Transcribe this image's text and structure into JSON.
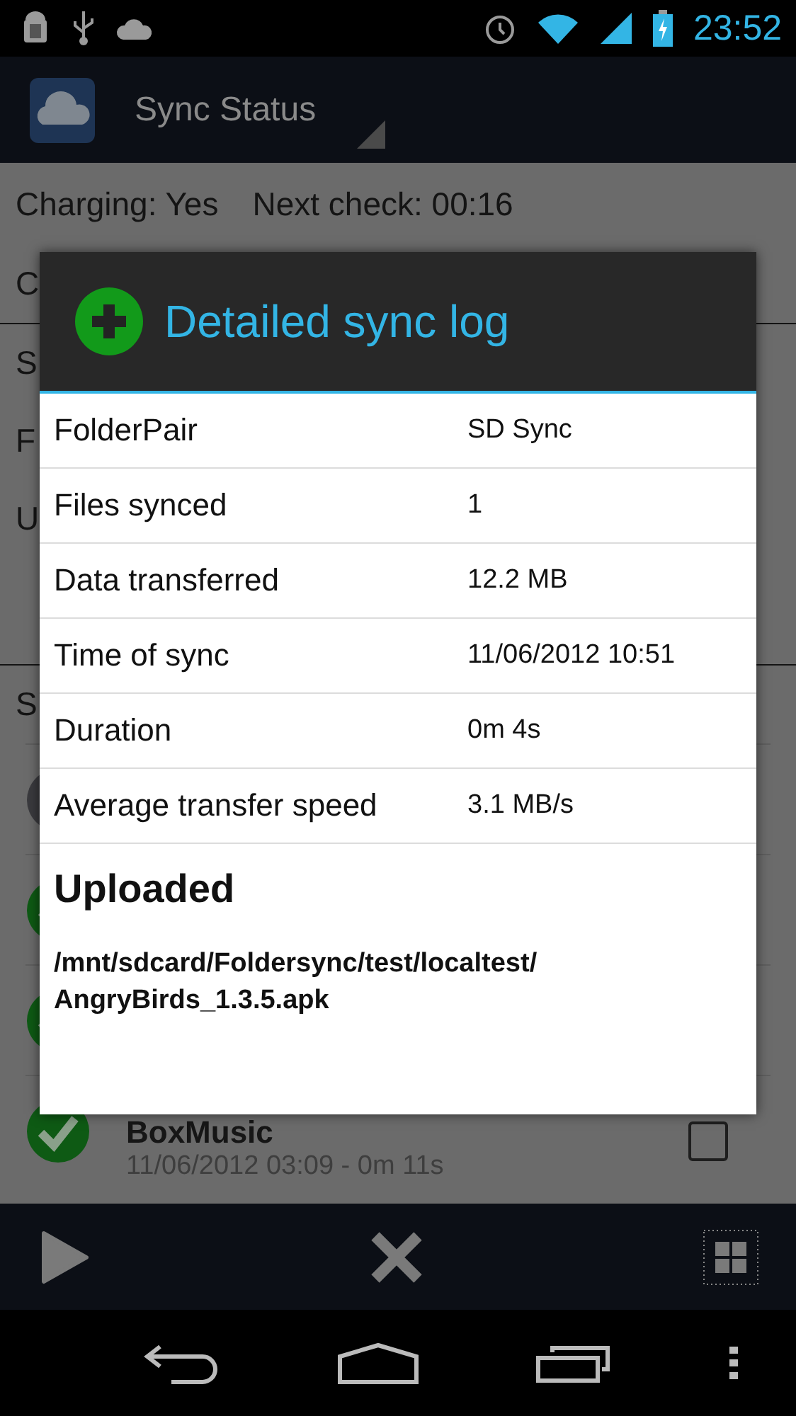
{
  "status_bar": {
    "time": "23:52"
  },
  "action_bar": {
    "title": "Sync Status"
  },
  "summary": {
    "charging": "Charging: Yes",
    "next_check": "Next check: 00:16"
  },
  "sections": [
    {
      "kind": "label",
      "text": "C"
    },
    {
      "kind": "rule"
    },
    {
      "kind": "label",
      "text": "S"
    },
    {
      "kind": "label",
      "text": "F"
    },
    {
      "kind": "label",
      "text": "U"
    },
    {
      "kind": "gap"
    },
    {
      "kind": "rule"
    },
    {
      "kind": "label",
      "text": "S"
    }
  ],
  "sync_rows": [
    {
      "kind": "idle"
    },
    {
      "kind": "done"
    },
    {
      "kind": "done"
    },
    {
      "kind": "done",
      "name": "BoxMusic",
      "detail": "11/06/2012 03:09 - 0m 11s",
      "checked": false
    }
  ],
  "dialog": {
    "title": "Detailed sync log",
    "rows": [
      {
        "label": "FolderPair",
        "value": "SD Sync"
      },
      {
        "label": "Files synced",
        "value": "1"
      },
      {
        "label": "Data transferred",
        "value": "12.2 MB"
      },
      {
        "label": "Time of sync",
        "value": "11/06/2012 10:51"
      },
      {
        "label": "Duration",
        "value": "0m 4s"
      },
      {
        "label": "Average transfer speed",
        "value": "3.1 MB/s"
      }
    ],
    "section_title": "Uploaded",
    "files": [
      "/mnt/sdcard/Foldersync/test/localtest/AngryBirds_1.3.5.apk"
    ]
  }
}
